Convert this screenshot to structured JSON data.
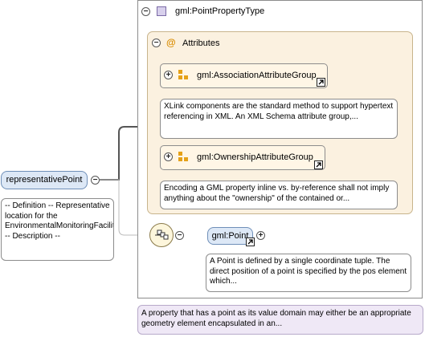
{
  "type_title": "gml:PointPropertyType",
  "attributes_label": "Attributes",
  "groups": [
    {
      "label": "gml:AssociationAttributeGroup",
      "description": "XLink components are the standard method to support hypertext referencing in XML. An XML Schema attribute group,..."
    },
    {
      "label": "gml:OwnershipAttributeGroup",
      "description": "Encoding a GML property inline vs. by-reference shall not imply anything about the \"ownership\" of the contained or..."
    }
  ],
  "root_element": {
    "label": "representativePoint",
    "description": "-- Definition -- Representative location for the EnvironmentalMonitoringFacility. -- Description --"
  },
  "child_element": {
    "label": "gml:Point",
    "description": "A Point is defined by a single coordinate tuple. The direct position of a point is specified by the pos element which..."
  },
  "type_description": "A property that has a point as its value domain may either be an appropriate geometry element encapsulated in an...",
  "toggle_collapse": "−",
  "toggle_expand": "+",
  "colors": {
    "element_fill": "#dde8f6",
    "attributes_fill": "#fbf1e0",
    "type_note_fill": "#efe8f6",
    "connector": "#555555"
  },
  "icons": {
    "type_icon": "complex-type-icon",
    "attributes_icon": "at-sign-icon",
    "group_icon": "attribute-group-icon",
    "sequence_icon": "sequence-icon",
    "reference_icon": "reference-arrow-icon"
  }
}
